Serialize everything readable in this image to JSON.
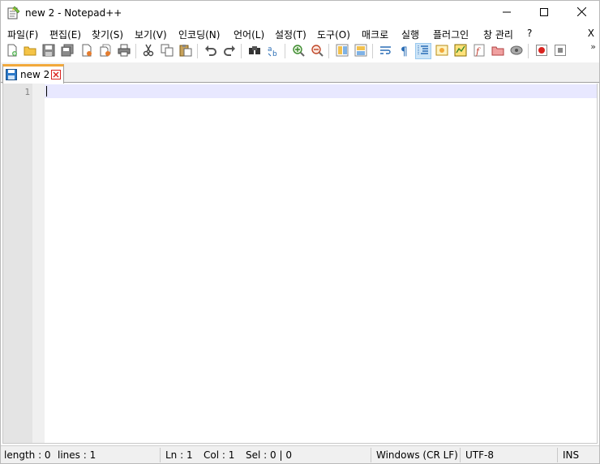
{
  "window": {
    "title": "new 2 - Notepad++"
  },
  "menu": {
    "items": [
      "파일(F)",
      "편집(E)",
      "찾기(S)",
      "보기(V)",
      "인코딩(N)",
      "언어(L)",
      "설정(T)",
      "도구(O)",
      "매크로",
      "실행",
      "플러그인",
      "창 관리",
      "?"
    ],
    "close_label": "X"
  },
  "toolbar": {
    "more_label": "»",
    "icons": [
      "new-file-icon",
      "open-file-icon",
      "save-icon",
      "save-all-icon",
      "close-icon",
      "close-all-icon",
      "print-icon",
      "cut-icon",
      "copy-icon",
      "paste-icon",
      "undo-icon",
      "redo-icon",
      "find-icon",
      "replace-icon",
      "zoom-in-icon",
      "zoom-out-icon",
      "sync-vertical-icon",
      "sync-horizontal-icon",
      "word-wrap-icon",
      "show-all-characters-icon",
      "indent-guide-icon",
      "user-defined-language-icon",
      "document-map-icon",
      "function-list-icon",
      "folder-as-workspace-icon",
      "document-monitor-icon",
      "record-macro-icon",
      "stop-macro-icon"
    ]
  },
  "tabs": [
    {
      "label": "new 2"
    }
  ],
  "editor": {
    "line_numbers": [
      "1"
    ]
  },
  "status": {
    "length": "length : 0",
    "lines": "lines : 1",
    "ln": "Ln : 1",
    "col": "Col : 1",
    "sel": "Sel : 0 | 0",
    "eol": "Windows (CR LF)",
    "encoding": "UTF-8",
    "mode": "INS"
  }
}
